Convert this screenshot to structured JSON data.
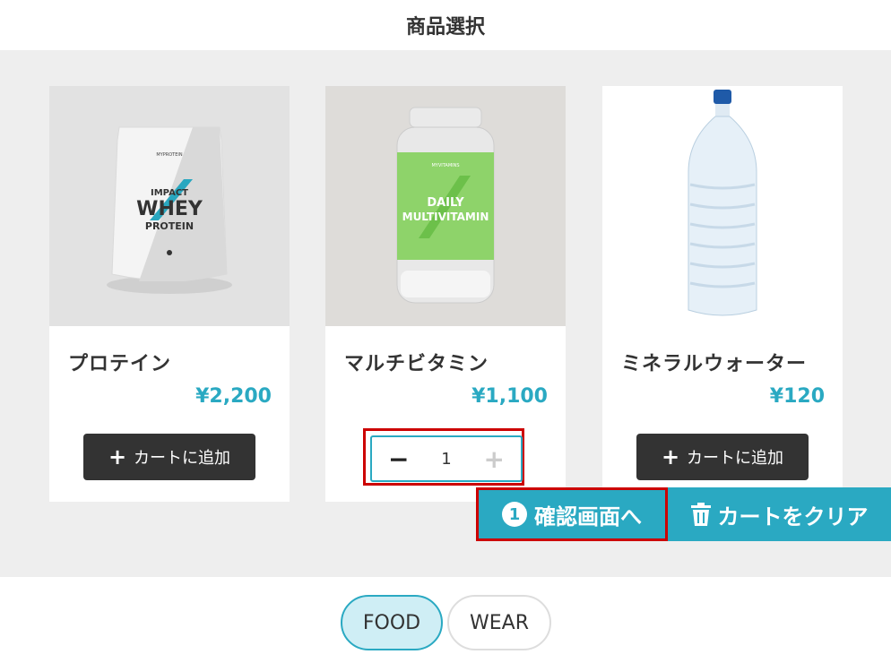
{
  "page": {
    "title": "商品選択"
  },
  "products": [
    {
      "name": "プロテイン",
      "price": "¥2,200",
      "action_label": "カートに追加",
      "image_icon": "protein-bag"
    },
    {
      "name": "マルチビタミン",
      "price": "¥1,100",
      "quantity": "1",
      "image_icon": "vitamin-bottle"
    },
    {
      "name": "ミネラルウォーター",
      "price": "¥120",
      "action_label": "カートに追加",
      "image_icon": "water-bottle"
    }
  ],
  "actions": {
    "confirm_label": "確認画面へ",
    "confirm_number": "1",
    "clear_label": "カートをクリア"
  },
  "tabs": [
    {
      "label": "FOOD",
      "active": true
    },
    {
      "label": "WEAR",
      "active": false
    }
  ],
  "colors": {
    "accent": "#2aa9c2",
    "dark_button": "#333333",
    "highlight": "#cc0000",
    "panel": "#eeeeee"
  }
}
